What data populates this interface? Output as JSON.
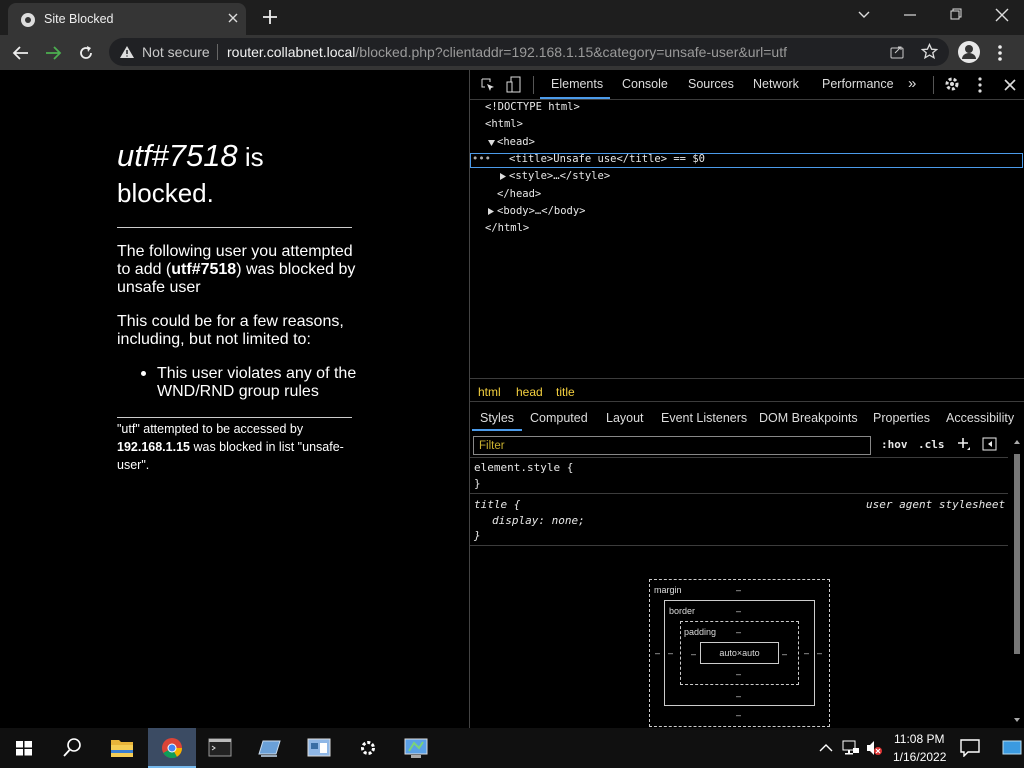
{
  "browser": {
    "tab_title": "Site Blocked",
    "security_label": "Not secure",
    "url_host": "router.collabnet.local",
    "url_path": "/blocked.php?clientaddr=192.168.1.15&category=unsafe-user&url=utf"
  },
  "page": {
    "heading_italic": "utf#7518",
    "heading_rest": " is blocked.",
    "p1_a": "The following user you attempted to add (",
    "p1_bold": "utf#7518",
    "p1_b": ") was blocked by unsafe user",
    "p2": "This could be for a few reasons, including, but not limited to:",
    "list_item": "This user violates any of the WND/RND group rules",
    "note_a": "\"utf\" attempted to be accessed by ",
    "note_bold": "192.168.1.15",
    "note_b": " was blocked in list \"unsafe-user\"."
  },
  "devtools": {
    "tabs": [
      "Elements",
      "Console",
      "Sources",
      "Network",
      "Performance"
    ],
    "more_tabs": "»",
    "dom_lines": [
      "<!DOCTYPE html>",
      "<html>",
      "<head>",
      "<title>Unsafe use</title> == $0",
      "<style>…</style>",
      "</head>",
      "<body>…</body>",
      "</html>"
    ],
    "breadcrumbs": [
      "html",
      "head",
      "title"
    ],
    "style_tabs": [
      "Styles",
      "Computed",
      "Layout",
      "Event Listeners",
      "DOM Breakpoints",
      "Properties",
      "Accessibility"
    ],
    "filter_placeholder": "Filter",
    "hov": ":hov",
    "cls": ".cls",
    "rule1_selector": "element.style {",
    "rule1_close": "}",
    "rule2_selector": "title {",
    "rule2_source": "user agent stylesheet",
    "rule2_decl": "display: none;",
    "rule2_close": "}",
    "box_model": {
      "margin": "margin",
      "border": "border",
      "padding": "padding",
      "content": "auto×auto",
      "dash": "–"
    }
  },
  "taskbar": {
    "time": "11:08 PM",
    "date": "1/16/2022"
  }
}
